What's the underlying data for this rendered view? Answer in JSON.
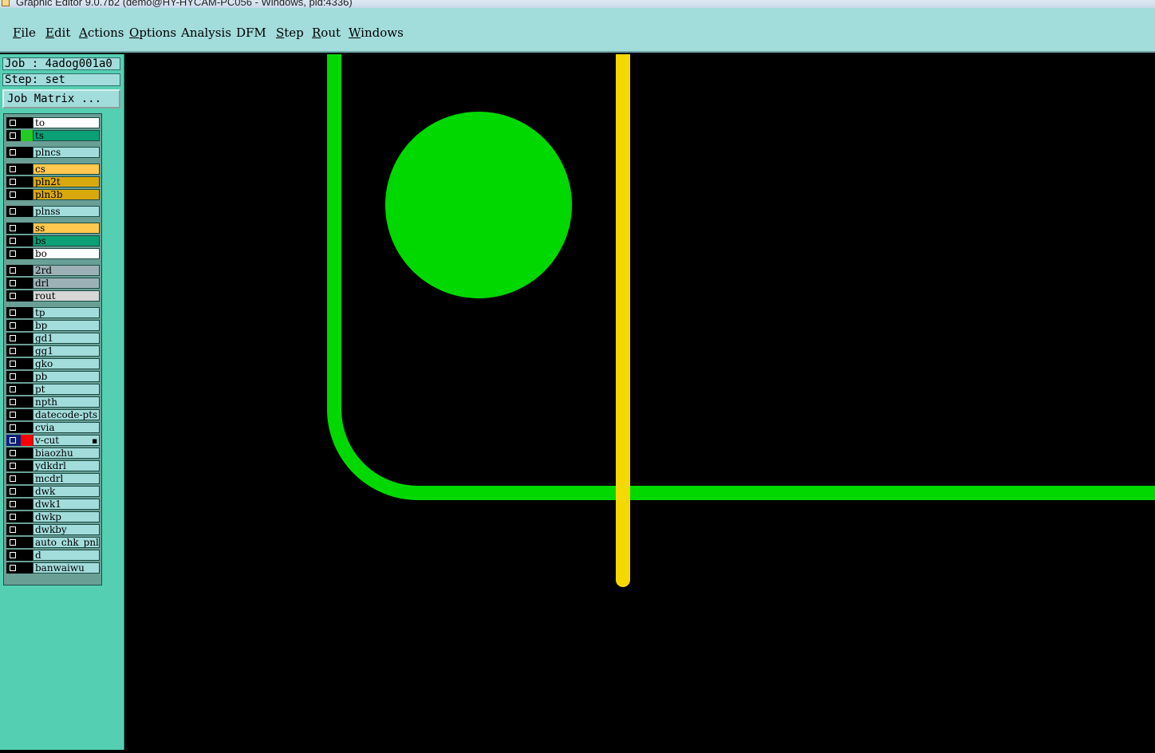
{
  "window": {
    "title": "Graphic Editor 9.0.7b2 (demo@HY-HYCAM-PC056 - Windows, pid:4336)"
  },
  "menu": [
    {
      "label": "File",
      "u": "F",
      "rest": "ile"
    },
    {
      "label": "Edit",
      "u": "E",
      "rest": "dit"
    },
    {
      "label": "Actions",
      "u": "A",
      "rest": "ctions"
    },
    {
      "label": "Options",
      "u": "O",
      "rest": "ptions"
    },
    {
      "label": "Analysis",
      "u": "",
      "rest": "Analysis"
    },
    {
      "label": "DFM",
      "u": "",
      "rest": "DFM"
    },
    {
      "label": "Step",
      "u": "S",
      "rest": "tep"
    },
    {
      "label": "Rout",
      "u": "R",
      "rest": "out"
    },
    {
      "label": "Windows",
      "u": "W",
      "rest": "indows"
    }
  ],
  "job": {
    "label": "Job : 4adog001a0"
  },
  "step": {
    "label": "Step: set"
  },
  "job_matrix_button": "Job Matrix ...",
  "layers": [
    {
      "name": "to",
      "color": "#ffffff",
      "swatch": "#000000"
    },
    {
      "name": "ts",
      "color": "#0d9f75",
      "swatch": "#22cc22"
    },
    {
      "name": "plncs",
      "color": "#a2dcdb",
      "swatch": "#000000"
    },
    {
      "name": "cs",
      "color": "#ffc84e",
      "swatch": "#000000"
    },
    {
      "name": "pln2t",
      "color": "#d9a80f",
      "swatch": "#000000"
    },
    {
      "name": "pln3b",
      "color": "#d9a80f",
      "swatch": "#000000"
    },
    {
      "name": "plnss",
      "color": "#a2dcdb",
      "swatch": "#000000"
    },
    {
      "name": "ss",
      "color": "#ffc84e",
      "swatch": "#000000"
    },
    {
      "name": "bs",
      "color": "#0d9f75",
      "swatch": "#000000"
    },
    {
      "name": "bo",
      "color": "#ffffff",
      "swatch": "#000000"
    },
    {
      "name": "2rd",
      "color": "#9cb1b6",
      "swatch": "#000000"
    },
    {
      "name": "drl",
      "color": "#9cb1b6",
      "swatch": "#000000"
    },
    {
      "name": "rout",
      "color": "#d7d7d7",
      "swatch": "#000000"
    },
    {
      "name": "tp",
      "color": "#a2dcdb",
      "swatch": "#000000"
    },
    {
      "name": "bp",
      "color": "#a2dcdb",
      "swatch": "#000000"
    },
    {
      "name": "gd1",
      "color": "#a2dcdb",
      "swatch": "#000000"
    },
    {
      "name": "gg1",
      "color": "#a2dcdb",
      "swatch": "#000000"
    },
    {
      "name": "gko",
      "color": "#a2dcdb",
      "swatch": "#000000"
    },
    {
      "name": "pb",
      "color": "#a2dcdb",
      "swatch": "#000000"
    },
    {
      "name": "pt",
      "color": "#a2dcdb",
      "swatch": "#000000"
    },
    {
      "name": "npth",
      "color": "#a2dcdb",
      "swatch": "#000000"
    },
    {
      "name": "datecode-pts",
      "color": "#a2dcdb",
      "swatch": "#000000"
    },
    {
      "name": "cvia",
      "color": "#a2dcdb",
      "swatch": "#000000"
    },
    {
      "name": "v-cut",
      "color": "#a2dcdb",
      "swatch": "#ff0000",
      "selected": true,
      "mark": "■"
    },
    {
      "name": "biaozhu",
      "color": "#a2dcdb",
      "swatch": "#000000"
    },
    {
      "name": "ydkdrl",
      "color": "#a2dcdb",
      "swatch": "#000000"
    },
    {
      "name": "mcdrl",
      "color": "#a2dcdb",
      "swatch": "#000000"
    },
    {
      "name": "dwk",
      "color": "#a2dcdb",
      "swatch": "#000000"
    },
    {
      "name": "dwk1",
      "color": "#a2dcdb",
      "swatch": "#000000"
    },
    {
      "name": "dwkp",
      "color": "#a2dcdb",
      "swatch": "#000000"
    },
    {
      "name": "dwkby",
      "color": "#a2dcdb",
      "swatch": "#000000"
    },
    {
      "name": "auto_chk_pnl",
      "color": "#a2dcdb",
      "swatch": "#000000"
    },
    {
      "name": "d",
      "color": "#a2dcdb",
      "swatch": "#000000"
    },
    {
      "name": "banwaiwu",
      "color": "#a2dcdb",
      "swatch": "#000000"
    }
  ],
  "canvas": {
    "background": "#000000",
    "outline_color": "#00d800",
    "pad_color": "#00d800",
    "vcut_color": "#f5d800"
  }
}
